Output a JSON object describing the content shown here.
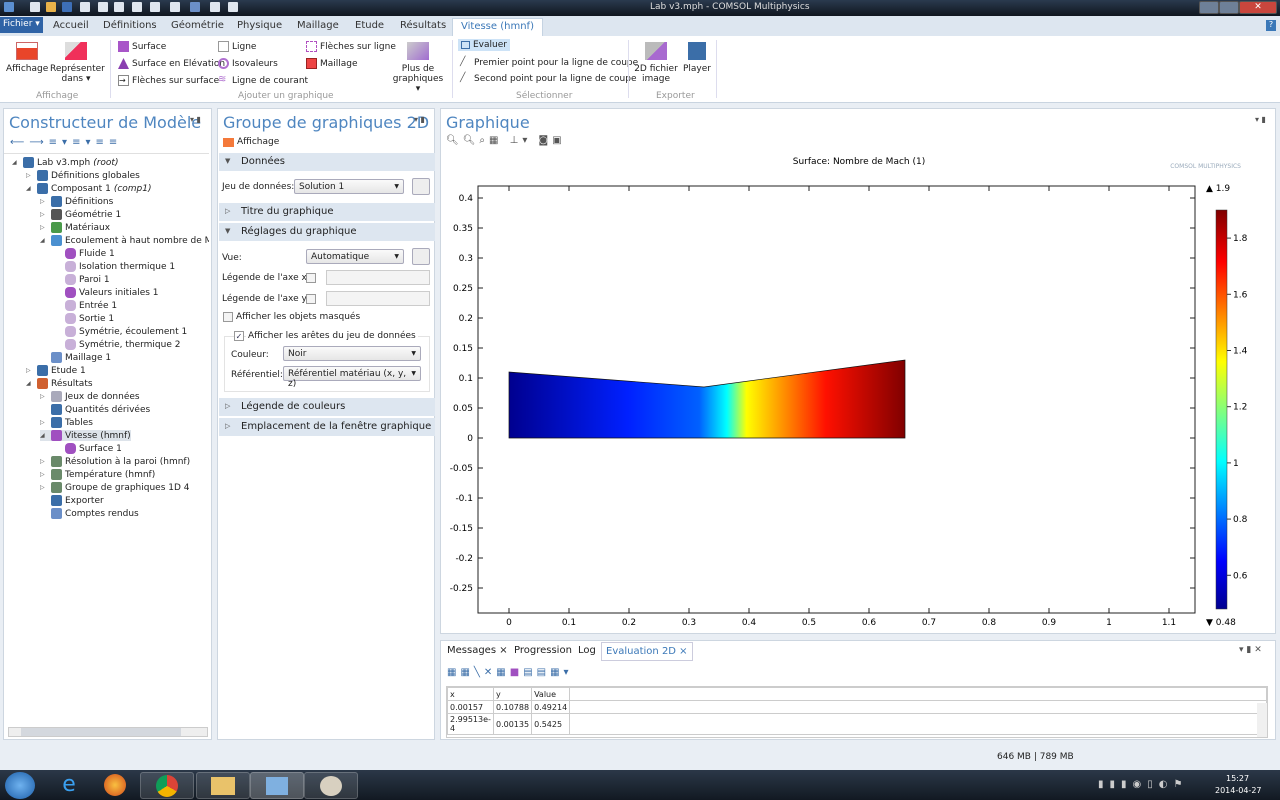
{
  "window": {
    "title": "Lab v3.mph - COMSOL Multiphysics"
  },
  "ribbon": {
    "file_label": "Fichier ▾",
    "tabs": [
      "Accueil",
      "Définitions",
      "Géométrie",
      "Physique",
      "Maillage",
      "Etude",
      "Résultats",
      "Vitesse (hmnf)"
    ],
    "affichage": {
      "btn1": "Affichage",
      "btn2_l1": "Représenter",
      "btn2_l2": "dans ▾",
      "group": "Affichage"
    },
    "ajouter": {
      "items": [
        "Surface",
        "Surface en Elévation",
        "Flèches sur surface",
        "Ligne",
        "Isovaleurs",
        "Ligne de courant",
        "Flèches sur ligne",
        "Maillage"
      ],
      "more_l1": "Plus de",
      "more_l2": "graphiques ▾",
      "group": "Ajouter un graphique"
    },
    "selectionner": {
      "items": [
        "Evaluer",
        "Premier point pour la ligne de coupe",
        "Second point pour la ligne de coupe"
      ],
      "group": "Sélectionner"
    },
    "exporter": {
      "img_l1": "2D fichier",
      "img_l2": "image",
      "player": "Player",
      "group": "Exporter"
    }
  },
  "model_builder": {
    "title": "Constructeur de Modèle",
    "tree": [
      {
        "label": "Lab v3.mph",
        "suffix": "(root)"
      },
      {
        "label": "Définitions globales"
      },
      {
        "label": "Composant 1",
        "suffix": "(comp1)"
      },
      {
        "label": "Définitions"
      },
      {
        "label": "Géométrie 1"
      },
      {
        "label": "Matériaux"
      },
      {
        "label": "Ecoulement à haut nombre de Mach"
      },
      {
        "label": "Fluide 1"
      },
      {
        "label": "Isolation thermique 1"
      },
      {
        "label": "Paroi 1"
      },
      {
        "label": "Valeurs initiales 1"
      },
      {
        "label": "Entrée 1"
      },
      {
        "label": "Sortie 1"
      },
      {
        "label": "Symétrie, écoulement 1"
      },
      {
        "label": "Symétrie, thermique 2"
      },
      {
        "label": "Maillage 1"
      },
      {
        "label": "Etude 1"
      },
      {
        "label": "Résultats"
      },
      {
        "label": "Jeux de données"
      },
      {
        "label": "Quantités dérivées"
      },
      {
        "label": "Tables"
      },
      {
        "label": "Vitesse (hmnf)"
      },
      {
        "label": "Surface 1"
      },
      {
        "label": "Résolution à la paroi (hmnf)"
      },
      {
        "label": "Température (hmnf)"
      },
      {
        "label": "Groupe de graphiques 1D 4"
      },
      {
        "label": "Exporter"
      },
      {
        "label": "Comptes rendus"
      }
    ]
  },
  "settings": {
    "title": "Groupe de graphiques 2D",
    "affichage": "Affichage",
    "sections": {
      "donnees": "Données",
      "titre": "Titre du graphique",
      "reglages": "Réglages du graphique",
      "legende": "Légende de couleurs",
      "emplacement": "Emplacement de la fenêtre graphique"
    },
    "dataset_label": "Jeu de données:",
    "dataset_value": "Solution 1",
    "vue_label": "Vue:",
    "vue_value": "Automatique",
    "xaxis_label": "Légende de l'axe x:",
    "yaxis_label": "Légende de l'axe y:",
    "hidden_label": "Afficher les objets masqués",
    "hidden_checked": false,
    "edges_label": "Afficher les arêtes du jeu de données",
    "edges_checked": true,
    "couleur_label": "Couleur:",
    "couleur_value": "Noir",
    "ref_label": "Référentiel:",
    "ref_value": "Référentiel matériau  (x, y, z)"
  },
  "graphics": {
    "title": "Graphique",
    "plot_title": "Surface: Nombre de Mach (1)",
    "logo": "COMSOL MULTIPHYSICS",
    "x_ticks": [
      "0",
      "0.1",
      "0.2",
      "0.3",
      "0.4",
      "0.5",
      "0.6",
      "0.7",
      "0.8",
      "0.9",
      "1",
      "1.1"
    ],
    "y_ticks": [
      "0.4",
      "0.35",
      "0.3",
      "0.25",
      "0.2",
      "0.15",
      "0.1",
      "0.05",
      "0",
      "-0.05",
      "-0.1",
      "-0.15",
      "-0.2",
      "-0.25"
    ],
    "colorbar": {
      "max_label": "▲ 1.9",
      "min_label": "▼ 0.48",
      "ticks": [
        "1.8",
        "1.6",
        "1.4",
        "1.2",
        "1",
        "0.8",
        "0.6"
      ],
      "min": 0.48,
      "max": 1.9,
      "colormap": "rainbow"
    }
  },
  "bottom": {
    "tabs": [
      "Messages ×",
      "Progression",
      "Log",
      "Evaluation 2D ×"
    ],
    "columns": [
      "x",
      "y",
      "Value"
    ],
    "rows": [
      [
        "0.00157",
        "0.10788",
        "0.49214"
      ],
      [
        "2.99513e-4",
        "0.00135",
        "0.5425"
      ]
    ]
  },
  "status": {
    "memory": "646 MB | 789 MB"
  },
  "taskbar": {
    "time": "15:27",
    "date": "2014-04-27"
  }
}
